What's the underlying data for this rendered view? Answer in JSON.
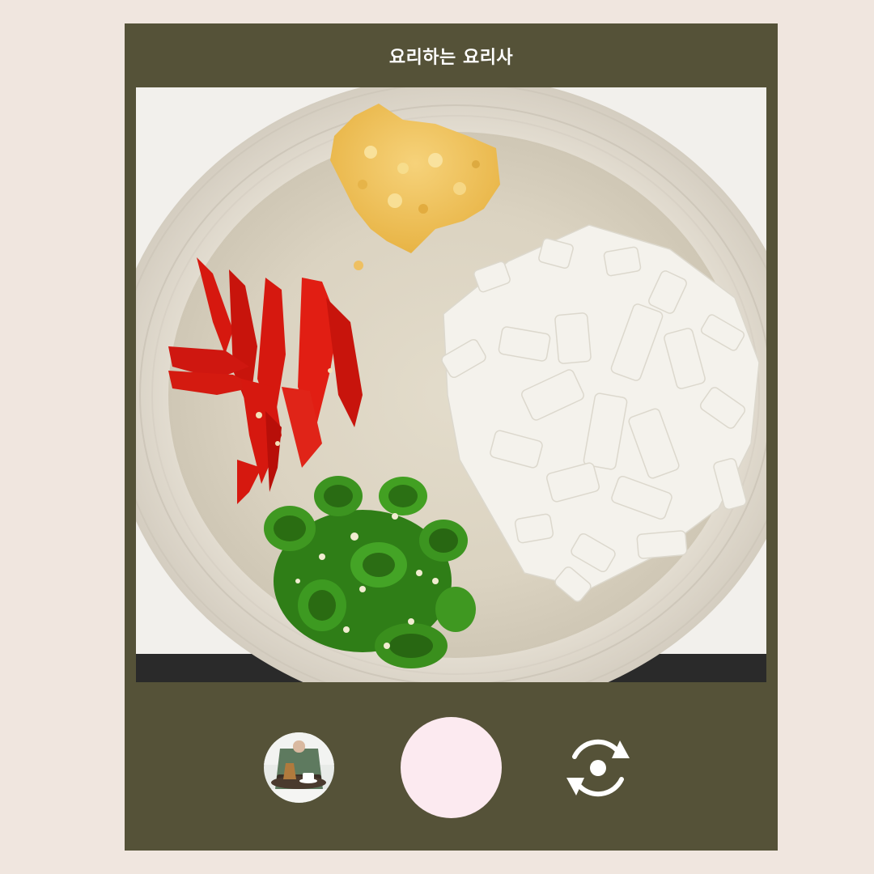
{
  "app": {
    "title": "요리하는 요리사"
  },
  "controls": {
    "gallery_icon": "gallery-thumbnail-icon",
    "shutter_icon": "shutter-button",
    "flip_icon": "flip-camera-icon"
  },
  "colors": {
    "background": "#f0e6df",
    "frame": "#555238",
    "shutter": "#fceaf0",
    "text": "#ffffff"
  }
}
